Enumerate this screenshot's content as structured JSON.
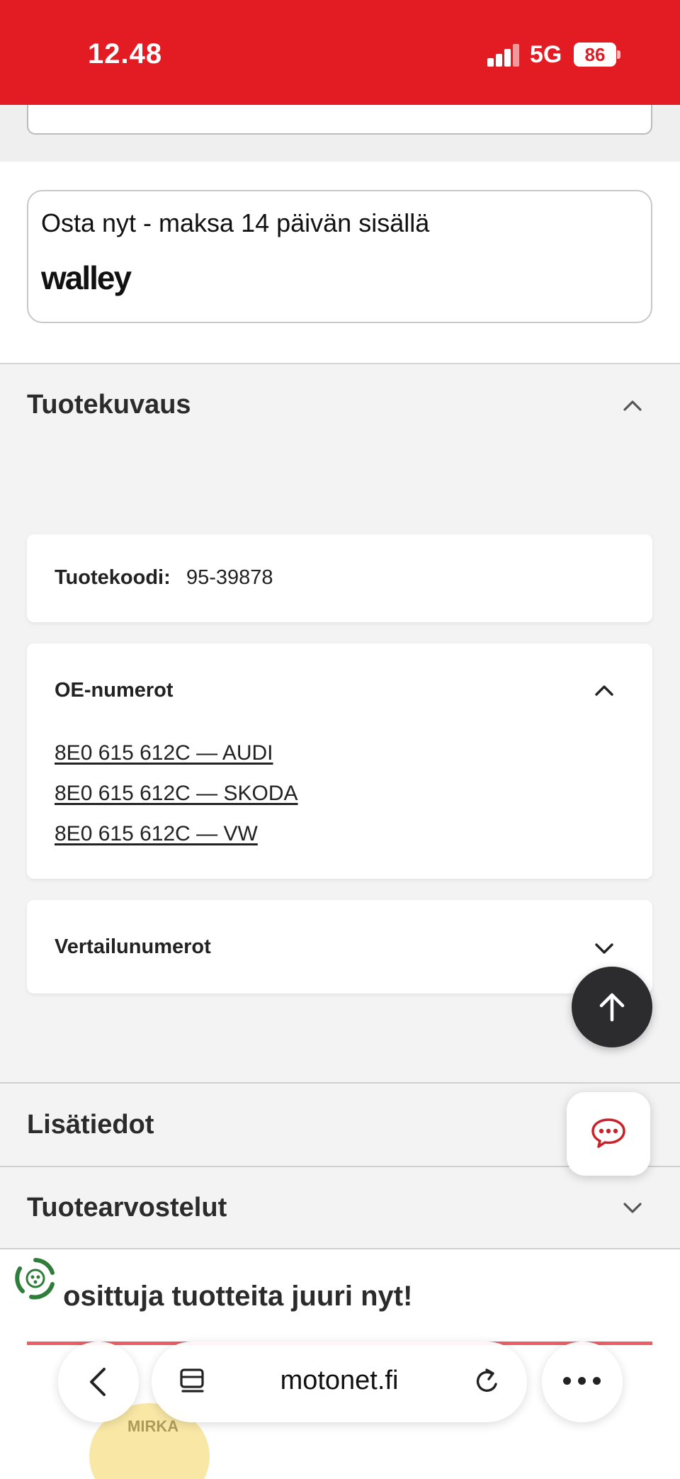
{
  "status_bar": {
    "time": "12.48",
    "network": "5G",
    "battery": "86"
  },
  "payment": {
    "text": "Osta nyt - maksa 14 päivän sisällä",
    "logo_label": "walley"
  },
  "description": {
    "title": "Tuotekuvaus",
    "product_code_label": "Tuotekoodi:",
    "product_code_value": "95-39878",
    "oe_title": "OE-numerot",
    "oe_numbers": [
      "8E0 615 612C — AUDI",
      "8E0 615 612C — SKODA",
      "8E0 615 612C — VW"
    ],
    "comparison_title": "Vertailunumerot"
  },
  "sections": {
    "additional_info": "Lisätiedot",
    "reviews": "Tuotearvostelut"
  },
  "popular": {
    "title": "Suosittuja tuotteita juuri nyt!",
    "product_brand": "MIRKA"
  },
  "browser": {
    "url": "motonet.fi"
  },
  "colors": {
    "brand_red": "#e31b23",
    "fab_dark": "#2c2c2e",
    "eco_green": "#2f7d3a"
  }
}
